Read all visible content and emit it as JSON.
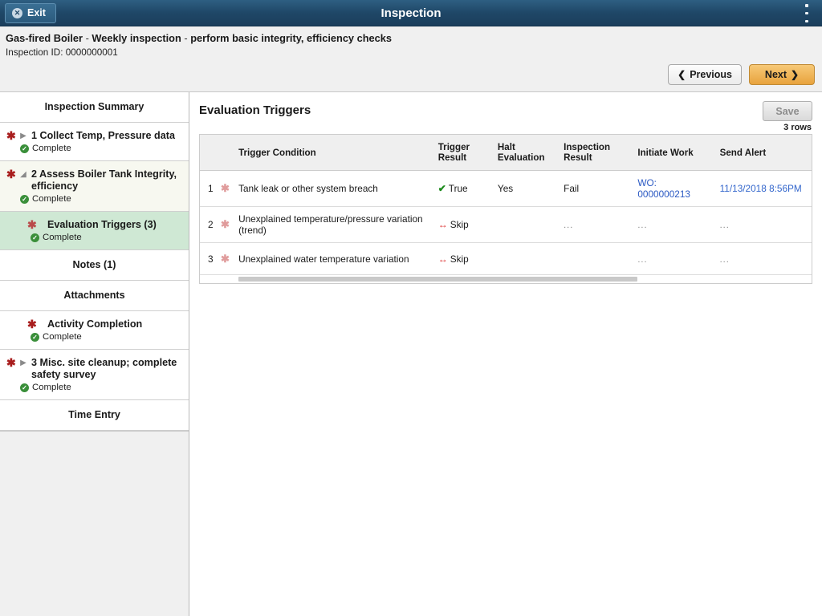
{
  "topbar": {
    "exit_label": "Exit",
    "exit_icon": "close-circle-icon",
    "title": "Inspection",
    "menu_icon": "kebab-menu-icon"
  },
  "pagehead": {
    "asset": "Gas-fired Boiler",
    "sep1": " - ",
    "activity": "Weekly inspection",
    "sep2": " - ",
    "description": "perform basic integrity, efficiency checks",
    "inspection_id_line": "Inspection ID: 0000000001",
    "previous_label": "Previous",
    "next_label": "Next",
    "previous_icon": "chevron-left-icon",
    "next_icon": "chevron-right-icon"
  },
  "sidebar": {
    "summary_label": "Inspection Summary",
    "items": [
      {
        "title": "1 Collect Temp, Pressure data",
        "status": "Complete",
        "triangle": "▶",
        "required_icon": "required-asterisk-icon",
        "status_icon": "complete-check-icon"
      },
      {
        "title": "2 Assess Boiler Tank Integrity, efficiency",
        "status": "Complete",
        "triangle": "◢",
        "required_icon": "required-asterisk-icon",
        "status_icon": "complete-check-icon"
      }
    ],
    "sub_items": [
      {
        "title": "Evaluation Triggers (3)",
        "status": "Complete",
        "required_icon": "required-asterisk-icon",
        "status_icon": "complete-check-icon"
      },
      {
        "title": "Notes (1)"
      },
      {
        "title": "Attachments"
      },
      {
        "title": "Activity Completion",
        "status": "Complete",
        "required_icon": "required-asterisk-icon",
        "status_icon": "complete-check-icon"
      }
    ],
    "item3": {
      "title": "3 Misc. site cleanup; complete safety survey",
      "status": "Complete",
      "triangle": "▶",
      "required_icon": "required-asterisk-icon",
      "status_icon": "complete-check-icon"
    },
    "time_entry_label": "Time Entry"
  },
  "main": {
    "title": "Evaluation Triggers",
    "save_label": "Save",
    "row_count": "3 rows",
    "table": {
      "headers": {
        "num": "",
        "star": "",
        "condition": "Trigger Condition",
        "trigger_result": "Trigger Result",
        "halt_evaluation": "Halt Evaluation",
        "inspection_result": "Inspection Result",
        "initiate_work": "Initiate Work",
        "send_alert": "Send Alert"
      },
      "rows": [
        {
          "num": "1",
          "star": "✱",
          "condition": "Tank leak or other system breach",
          "result_icon": "check-icon",
          "result_glyph": "✔",
          "trigger_result": "True",
          "halt_evaluation": "Yes",
          "inspection_result": "Fail",
          "initiate_work": "WO: 0000000213",
          "send_alert": "11/13/2018 8:56PM"
        },
        {
          "num": "2",
          "star": "✱",
          "condition": "Unexplained temperature/pressure variation (trend)",
          "result_icon": "skip-arrow-icon",
          "result_glyph": "↔",
          "trigger_result": "Skip",
          "halt_evaluation": "",
          "inspection_result": "...",
          "initiate_work": "...",
          "send_alert": "..."
        },
        {
          "num": "3",
          "star": "✱",
          "condition": "Unexplained water temperature variation",
          "result_icon": "skip-arrow-icon",
          "result_glyph": "↔",
          "trigger_result": "Skip",
          "halt_evaluation": "",
          "inspection_result": "",
          "initiate_work": "...",
          "send_alert": "..."
        }
      ]
    }
  },
  "colors": {
    "topbar": "#1f4767",
    "accent_next": "#e8a33d",
    "active_item": "#cfe8d4",
    "cream_item": "#f7f8f0",
    "required": "#a81d1d",
    "complete": "#3a8f3a",
    "link": "#2b59c3",
    "skip": "#dc3030"
  }
}
